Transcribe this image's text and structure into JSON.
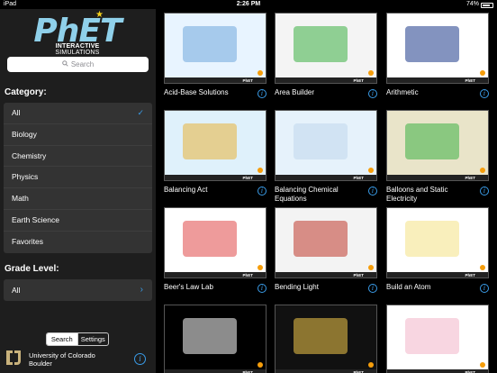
{
  "status_bar": {
    "carrier": "iPad",
    "time": "2:26 PM",
    "battery": "74%",
    "battery_level": 0.74
  },
  "sidebar": {
    "logo": {
      "brand": "PhET",
      "subtitle_bold": "INTERACTIVE",
      "subtitle": "SIMULATIONS"
    },
    "search_placeholder": "Search",
    "category_title": "Category:",
    "categories": [
      {
        "label": "All",
        "selected": true
      },
      {
        "label": "Biology",
        "selected": false
      },
      {
        "label": "Chemistry",
        "selected": false
      },
      {
        "label": "Physics",
        "selected": false
      },
      {
        "label": "Math",
        "selected": false
      },
      {
        "label": "Earth Science",
        "selected": false
      },
      {
        "label": "Favorites",
        "selected": false
      }
    ],
    "grade_title": "Grade Level:",
    "grade_value": "All",
    "tabs": [
      {
        "label": "Search",
        "active": true
      },
      {
        "label": "Settings",
        "active": false
      }
    ],
    "footer": {
      "line1": "University of Colorado",
      "line2": "Boulder"
    },
    "colors": {
      "background": "#1e1e1e",
      "list": "#333333",
      "accent": "#3a9ce8",
      "cu_gold": "#c9b27c"
    }
  },
  "sims": [
    {
      "title": "Acid-Base Solutions",
      "theme": "#e8f4ff",
      "accent": "#6fa8dc"
    },
    {
      "title": "Area Builder",
      "theme": "#f4f4f4",
      "accent": "#3cb043"
    },
    {
      "title": "Arithmetic",
      "theme": "#ffffff",
      "accent": "#1e3a8a"
    },
    {
      "title": "Balancing Act",
      "theme": "#dff1fb",
      "accent": "#e8b23a"
    },
    {
      "title": "Balancing Chemical Equations",
      "theme": "#e6f2fb",
      "accent": "#c0d7ec"
    },
    {
      "title": "Balloons and Static Electricity",
      "theme": "#e9e4c9",
      "accent": "#3cb043"
    },
    {
      "title": "Beer's Law Lab",
      "theme": "#ffffff",
      "accent": "#e04848"
    },
    {
      "title": "Bending Light",
      "theme": "#f3f3f3",
      "accent": "#c0392b"
    },
    {
      "title": "Build an Atom",
      "theme": "#ffffff",
      "accent": "#f4e285"
    },
    {
      "title": "",
      "theme": "#000000",
      "accent": "#ffffff"
    },
    {
      "title": "",
      "theme": "#111111",
      "accent": "#f2c84b"
    },
    {
      "title": "",
      "theme": "#ffffff",
      "accent": "#f2b5c8"
    }
  ]
}
